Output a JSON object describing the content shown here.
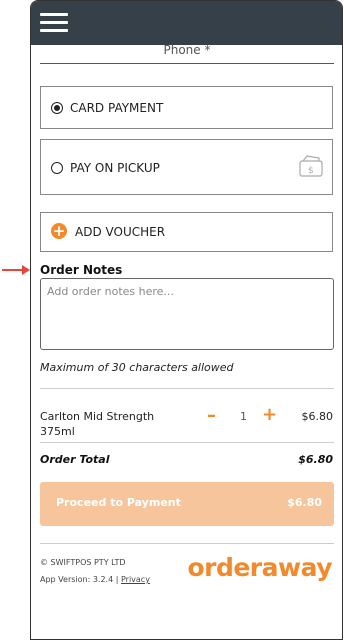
{
  "form": {
    "phone_label": "Phone *"
  },
  "payment_options": [
    {
      "label": "CARD PAYMENT",
      "selected": true
    },
    {
      "label": "PAY ON PICKUP",
      "selected": false
    }
  ],
  "voucher": {
    "label": "ADD VOUCHER"
  },
  "order_notes": {
    "title": "Order Notes",
    "placeholder": "Add order notes here...",
    "hint": "Maximum of 30 characters allowed"
  },
  "cart": {
    "items": [
      {
        "name": "Carlton Mid Strength 375ml",
        "quantity": "1",
        "price": "$6.80"
      }
    ],
    "total_label": "Order Total",
    "total_value": "$6.80"
  },
  "payment_button": {
    "label": "Proceed to Payment",
    "amount": "$6.80"
  },
  "footer": {
    "copyright": "© SWIFTPOS PTY LTD",
    "version": "App Version: 3.2.4 |",
    "privacy": "Privacy",
    "brand": "orderaway"
  },
  "colors": {
    "accent": "#f2892b",
    "header": "#364049",
    "button_disabled": "#f7c59c",
    "annotation_arrow": "#e8453c"
  },
  "icons": [
    "menu-icon",
    "radio-icon",
    "cash-icon",
    "plus-circle-icon",
    "minus-icon",
    "plus-icon",
    "arrow-right-icon"
  ]
}
